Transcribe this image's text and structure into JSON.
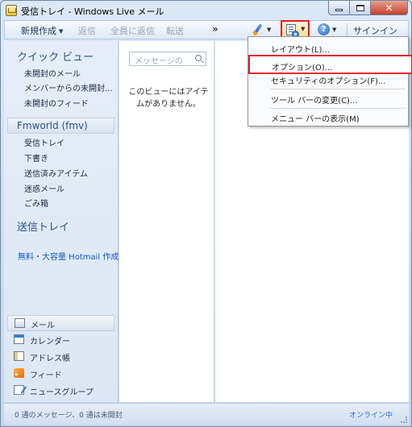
{
  "window": {
    "title": "受信トレイ - Windows Live メール"
  },
  "toolbar": {
    "new_label": "新規作成",
    "reply_label": "返信",
    "reply_all_label": "全員に返信",
    "forward_label": "転送",
    "more_label": "»",
    "signin_label": "サインイン",
    "highlight_color": "#e21e2e"
  },
  "nav": {
    "quick_views_title": "クイック ビュー",
    "quick_views": [
      "未開封のメール",
      "メンバーからの未開封...",
      "未開封のフィード"
    ],
    "account_name": "Fmworld (fmv)",
    "folders": [
      "受信トレイ",
      "下書き",
      "送信済みアイテム",
      "迷惑メール",
      "ごみ箱"
    ],
    "outbox_title": "送信トレイ",
    "hotmail_link": "無料・大容量 Hotmail 作成"
  },
  "modules": [
    {
      "label": "メール",
      "icon": "mail-icon"
    },
    {
      "label": "カレンダー",
      "icon": "calendar-icon"
    },
    {
      "label": "アドレス帳",
      "icon": "address-book-icon"
    },
    {
      "label": "フィード",
      "icon": "feed-icon"
    },
    {
      "label": "ニュースグループ",
      "icon": "newsgroup-icon"
    }
  ],
  "message_list": {
    "search_placeholder": "メッセージの",
    "empty_text": "このビューにはアイテムがありません。"
  },
  "menu": {
    "items": [
      "レイアウト(L)...",
      "オプション(O)...",
      "セキュリティのオプション(F)...",
      "ツール バーの変更(C)...",
      "メニュー バーの表示(M)"
    ]
  },
  "status": {
    "left": "0 通のメッセージ、0 通は未開封",
    "right": "オンライン中"
  }
}
